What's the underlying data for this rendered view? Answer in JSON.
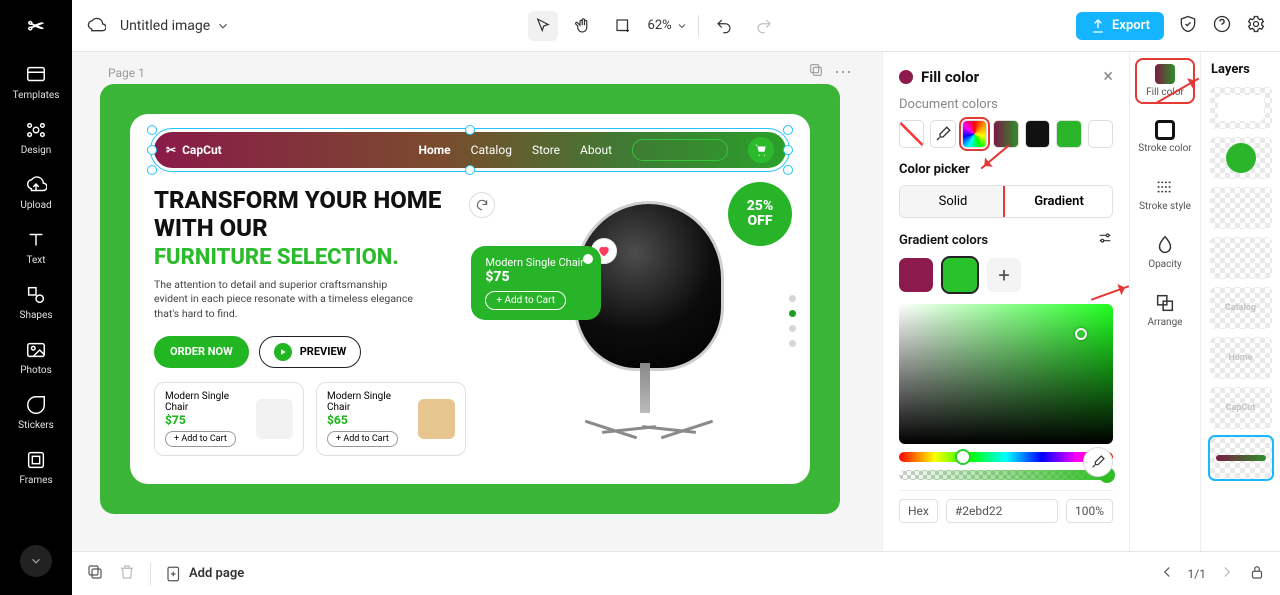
{
  "header": {
    "doc_title": "Untitled image",
    "zoom": "62%",
    "export": "Export"
  },
  "left_tools": {
    "templates": "Templates",
    "design": "Design",
    "upload": "Upload",
    "text": "Text",
    "shapes": "Shapes",
    "photos": "Photos",
    "stickers": "Stickers",
    "frames": "Frames"
  },
  "canvas": {
    "page_label": "Page 1",
    "brand": "CapCut",
    "nav": {
      "home": "Home",
      "catalog": "Catalog",
      "store": "Store",
      "about": "About"
    },
    "hero_title": "TRANSFORM YOUR HOME WITH OUR",
    "hero_title2": "FURNITURE SELECTION.",
    "hero_sub": "The attention to detail and superior craftsmanship evident in each piece resonate with a timeless elegance that's hard to find.",
    "order": "ORDER NOW",
    "preview": "PREVIEW",
    "badge_pct": "25%",
    "badge_off": "OFF",
    "popup_name": "Modern Single Chair",
    "popup_price": "$75",
    "popup_add": "+ Add to Cart",
    "mini": [
      {
        "name": "Modern Single Chair",
        "price": "$75",
        "add": "+ Add to Cart"
      },
      {
        "name": "Modern Single Chair",
        "price": "$65",
        "add": "+ Add to Cart"
      }
    ]
  },
  "fill_panel": {
    "title": "Fill color",
    "doc_colors": "Document colors",
    "picker_title": "Color picker",
    "tab_solid": "Solid",
    "tab_gradient": "Gradient",
    "grad_colors": "Gradient colors",
    "mode": "Hex",
    "hex": "#2ebd22",
    "alpha": "100%",
    "swatches": {
      "grad": "linear-gradient(90deg,#7b1a44,#2f8f2a)",
      "black": "#111",
      "green": "#2bb52b"
    }
  },
  "propstrip": {
    "fill": "Fill color",
    "stroke_color": "Stroke color",
    "stroke_style": "Stroke style",
    "opacity": "Opacity",
    "arrange": "Arrange"
  },
  "layers": {
    "title": "Layers",
    "thumb_labels": {
      "catalog": "Catalog",
      "home": "Home",
      "brand": "CapCut"
    }
  },
  "bottom": {
    "add_page": "Add page",
    "counter": "1/1"
  }
}
